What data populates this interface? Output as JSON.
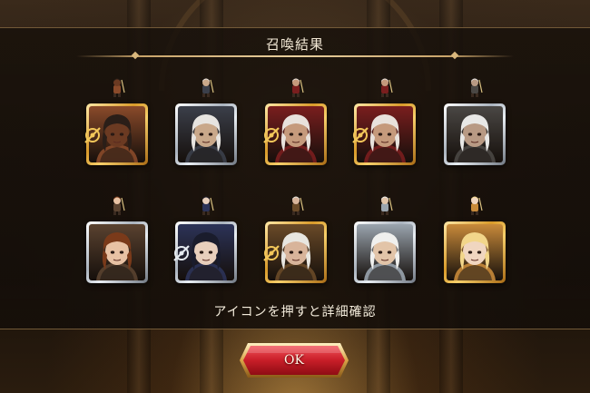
{
  "screen": {
    "title": "召喚結果",
    "hint": "アイコンを押すと詳細確認",
    "ok_label": "OK"
  },
  "colors": {
    "gold_frame": "#e0a33a",
    "silver_frame": "#c7ced6",
    "ok_button": "#d3262e",
    "text": "#f3e9d6"
  },
  "units": [
    {
      "id": "unit-1",
      "rarity": "gold",
      "has_emblem": true,
      "tone": "#6b3a22",
      "hair": "#2a1e18",
      "bg": "#8a4a2a",
      "sprite": "knight-sprite-icon"
    },
    {
      "id": "unit-2",
      "rarity": "silver",
      "has_emblem": false,
      "tone": "#c9a88a",
      "hair": "#e7e4e0",
      "bg": "#3b3f4a",
      "sprite": "dancer-sprite-icon"
    },
    {
      "id": "unit-3",
      "rarity": "gold",
      "has_emblem": true,
      "tone": "#c59a7c",
      "hair": "#e8e2dc",
      "bg": "#7a1e1e",
      "sprite": "priest-sprite-icon"
    },
    {
      "id": "unit-4",
      "rarity": "gold",
      "has_emblem": true,
      "tone": "#c59a7c",
      "hair": "#e8e2dc",
      "bg": "#7a1e1e",
      "sprite": "priest-sprite-icon"
    },
    {
      "id": "unit-5",
      "rarity": "silver",
      "has_emblem": false,
      "tone": "#b89a84",
      "hair": "#e8e8e6",
      "bg": "#4a4744",
      "sprite": "warrior-sprite-icon"
    },
    {
      "id": "unit-6",
      "rarity": "silver",
      "has_emblem": false,
      "tone": "#e8c2a4",
      "hair": "#7a3a1a",
      "bg": "#5a4230",
      "sprite": "lancer-sprite-icon"
    },
    {
      "id": "unit-7",
      "rarity": "silver",
      "has_emblem": true,
      "tone": "#e8cfbc",
      "hair": "#1a1c2c",
      "bg": "#2c3358",
      "sprite": "mage-sprite-icon"
    },
    {
      "id": "unit-8",
      "rarity": "gold",
      "has_emblem": true,
      "tone": "#d8b49a",
      "hair": "#e8e6e0",
      "bg": "#6a4a28",
      "sprite": "swordsman-sprite-icon"
    },
    {
      "id": "unit-9",
      "rarity": "silver",
      "has_emblem": false,
      "tone": "#e2c4a8",
      "hair": "#f0f0ee",
      "bg": "#9aa4ae",
      "sprite": "archer-sprite-icon"
    },
    {
      "id": "unit-10",
      "rarity": "gold",
      "has_emblem": false,
      "tone": "#f0d6c0",
      "hair": "#f2d68a",
      "bg": "#c88a3a",
      "sprite": "girl-sprite-icon"
    }
  ]
}
